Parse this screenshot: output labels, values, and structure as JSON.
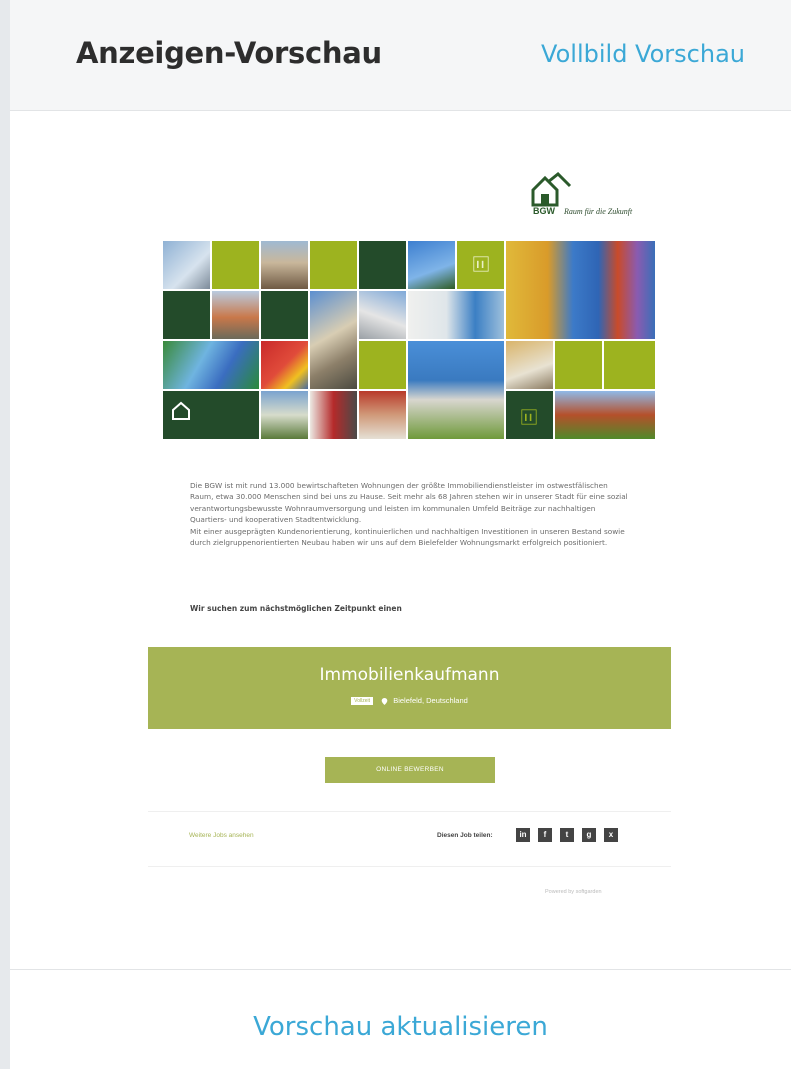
{
  "header": {
    "title": "Anzeigen-Vorschau",
    "fullscreen_link": "Vollbild Vorschau"
  },
  "ad": {
    "logo": {
      "name": "BGW",
      "tagline": "Raum für die Zukunft"
    },
    "intro_text": [
      "Die BGW ist mit rund 13.000 bewirtschafteten Wohnungen der größte Immobiliendienstleister im ostwestfälischen Raum, etwa 30.000 Menschen sind bei uns zu Hause. Seit mehr als 68 Jahren stehen wir in unserer Stadt für eine sozial verantwortungsbewusste Wohnraumversorgung und leisten im kommunalen Umfeld Beiträge zur nachhaltigen Quartiers- und kooperativen Stadtentwicklung.",
      "Mit einer ausgeprägten Kundenorientierung, kontinuierlichen und nachhaltigen Investitionen in unseren Bestand sowie durch zielgruppenorientierten Neubau haben wir uns auf dem Bielefelder Wohnungsmarkt erfolgreich positioniert."
    ],
    "search_line": "Wir suchen zum nächstmöglichen Zeitpunkt einen",
    "job": {
      "title": "Immobilienkaufmann",
      "badge": "Vollzeit",
      "location": "Bielefeld, Deutschland"
    },
    "apply_label": "ONLINE BEWERBEN",
    "more_jobs_label": "Weitere Jobs ansehen",
    "share_label": "Diesen Job teilen:",
    "share_icons": [
      "linkedin-icon",
      "facebook-icon",
      "twitter-icon",
      "googleplus-icon",
      "xing-icon"
    ],
    "powered_by": "Powered by softgarden"
  },
  "footer": {
    "refresh_link": "Vorschau aktualisieren"
  },
  "colors": {
    "accent_blue": "#3ba8d6",
    "olive": "#a6b455",
    "dark_green": "#234b2a",
    "lime": "#9db31f"
  }
}
